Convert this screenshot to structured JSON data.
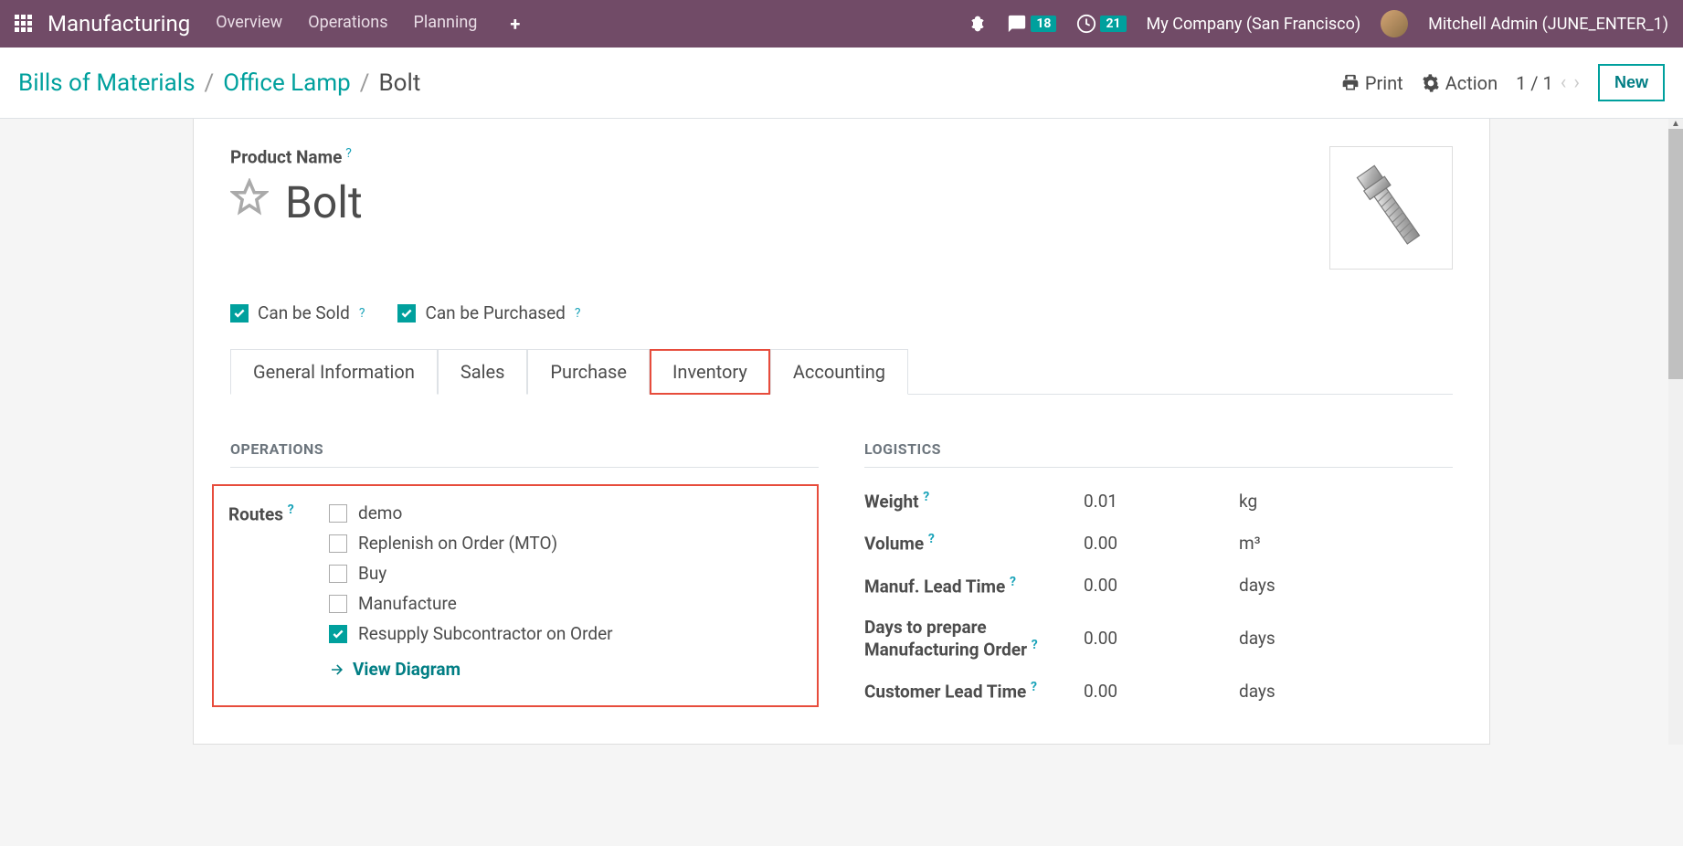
{
  "navbar": {
    "title": "Manufacturing",
    "links": [
      "Overview",
      "Operations",
      "Planning"
    ],
    "messages_badge": "18",
    "activities_badge": "21",
    "company": "My Company (San Francisco)",
    "user": "Mitchell Admin (JUNE_ENTER_1)"
  },
  "breadcrumb": {
    "root": "Bills of Materials",
    "parent": "Office Lamp",
    "current": "Bolt"
  },
  "controls": {
    "print": "Print",
    "action": "Action",
    "pager": "1 / 1",
    "new": "New"
  },
  "form": {
    "product_name_label": "Product Name",
    "product_name": "Bolt",
    "can_be_sold": "Can be Sold",
    "can_be_purchased": "Can be Purchased",
    "tabs": [
      "General Information",
      "Sales",
      "Purchase",
      "Inventory",
      "Accounting"
    ],
    "operations_title": "OPERATIONS",
    "logistics_title": "LOGISTICS",
    "routes_label": "Routes",
    "routes": [
      "demo",
      "Replenish on Order (MTO)",
      "Buy",
      "Manufacture",
      "Resupply Subcontractor on Order"
    ],
    "view_diagram": "View Diagram",
    "logistics": {
      "weight_label": "Weight",
      "weight_val": "0.01",
      "weight_unit": "kg",
      "volume_label": "Volume",
      "volume_val": "0.00",
      "volume_unit": "m³",
      "lead_label": "Manuf. Lead Time",
      "lead_val": "0.00",
      "lead_unit": "days",
      "prep_label": "Days to prepare Manufacturing Order",
      "prep_val": "0.00",
      "prep_unit": "days",
      "cust_label": "Customer Lead Time",
      "cust_val": "0.00",
      "cust_unit": "days"
    }
  }
}
